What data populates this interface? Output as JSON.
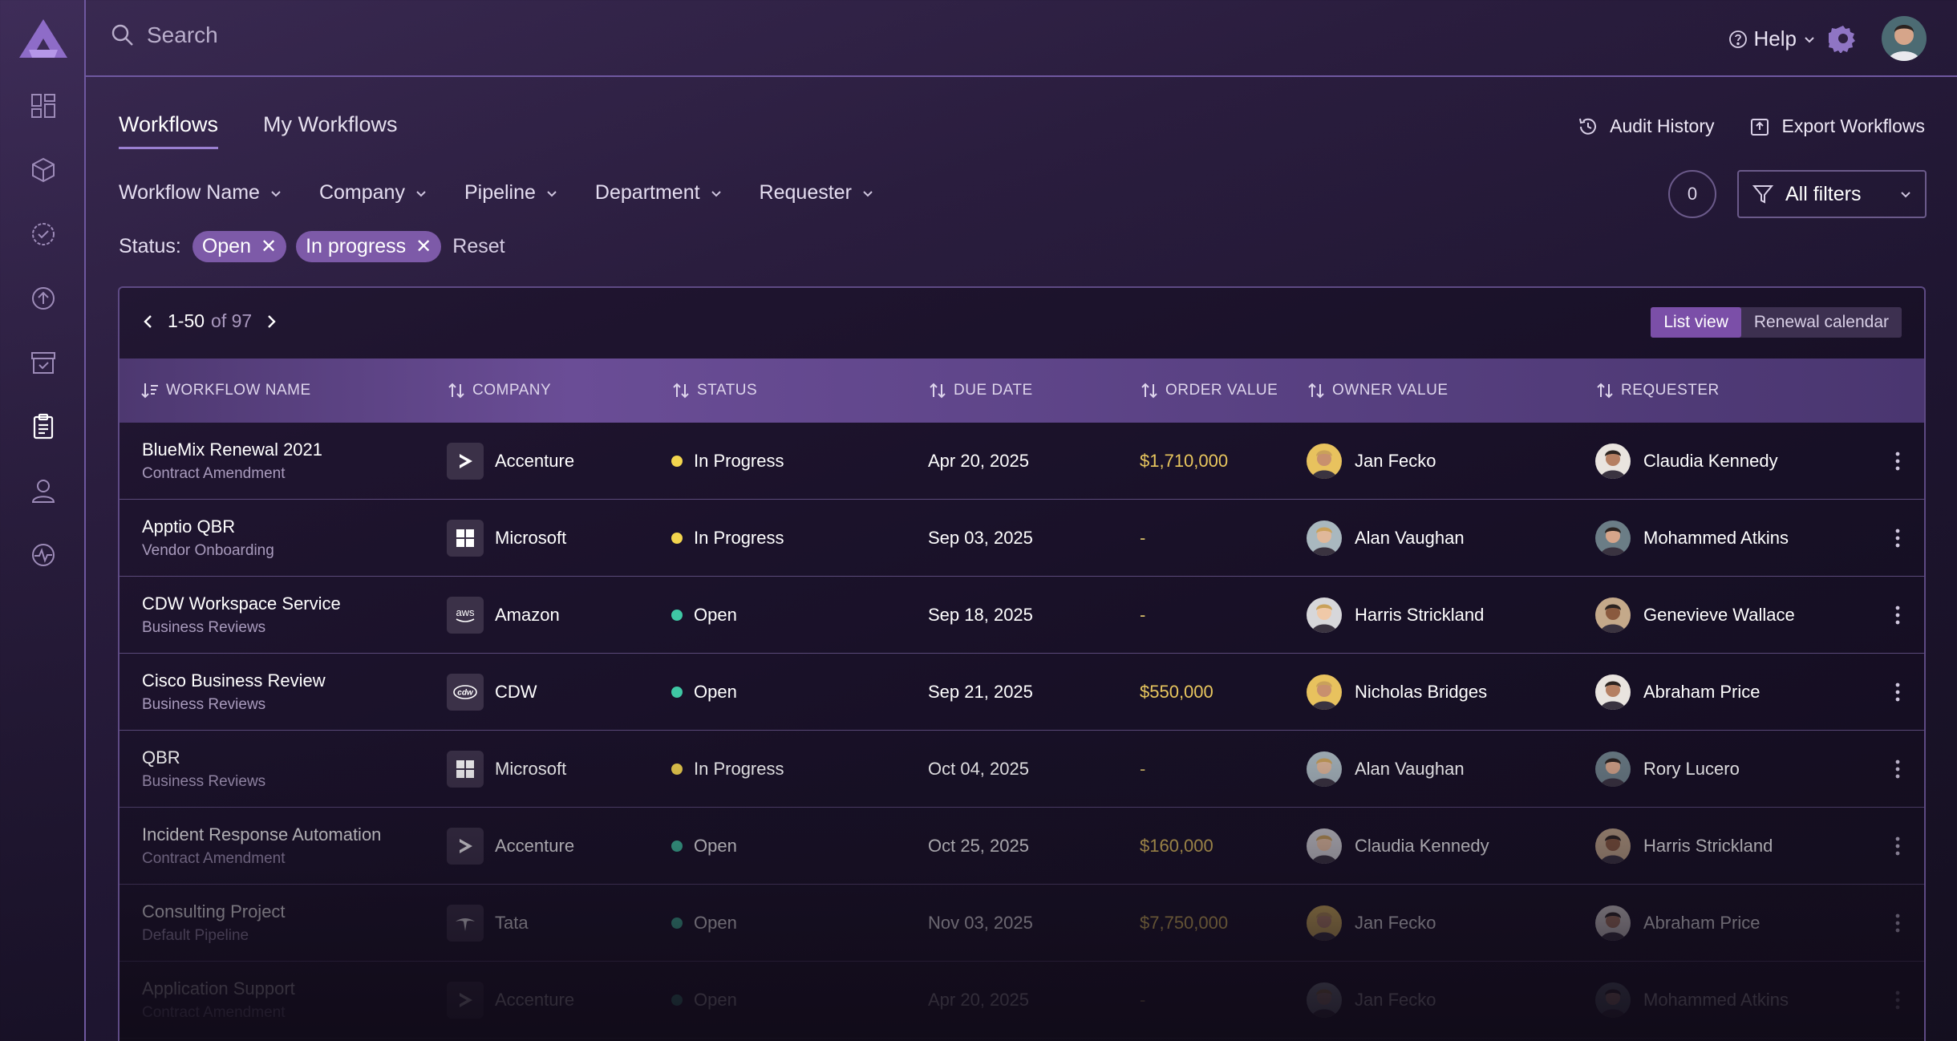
{
  "search": {
    "placeholder": "Search"
  },
  "header": {
    "help_label": "Help"
  },
  "tabs": [
    {
      "label": "Workflows"
    },
    {
      "label": "My Workflows"
    }
  ],
  "actions": {
    "audit": "Audit History",
    "export": "Export Workflows"
  },
  "filters": [
    {
      "label": "Workflow Name"
    },
    {
      "label": "Company"
    },
    {
      "label": "Pipeline"
    },
    {
      "label": "Department"
    },
    {
      "label": "Requester"
    }
  ],
  "filter_count": "0",
  "all_filters_label": "All filters",
  "status_filter": {
    "label": "Status:",
    "chips": [
      "Open",
      "In progress"
    ],
    "reset": "Reset"
  },
  "pager": {
    "range": "1-50",
    "of": "of 97"
  },
  "views": {
    "list": "List view",
    "calendar": "Renewal calendar"
  },
  "columns": [
    "WORKFLOW NAME",
    "COMPANY",
    "STATUS",
    "DUE DATE",
    "ORDER VALUE",
    "OWNER VALUE",
    "REQUESTER"
  ],
  "colors": {
    "accent": "#7b4fa8",
    "in_progress": "#f3d54e",
    "open": "#3fc7a4",
    "value": "#e9c75e"
  },
  "rows": [
    {
      "name": "BlueMix Renewal 2021",
      "pipeline": "Contract Amendment",
      "company": "Accenture",
      "company_icon": "accenture-icon",
      "status": "In Progress",
      "due": "Apr 20, 2025",
      "value": "$1,710,000",
      "owner": "Jan Fecko",
      "requester": "Claudia Kennedy"
    },
    {
      "name": "Apptio QBR",
      "pipeline": "Vendor Onboarding",
      "company": "Microsoft",
      "company_icon": "microsoft-icon",
      "status": "In Progress",
      "due": "Sep 03, 2025",
      "value": "-",
      "owner": "Alan Vaughan",
      "requester": "Mohammed Atkins"
    },
    {
      "name": "CDW Workspace Service",
      "pipeline": "Business Reviews",
      "company": "Amazon",
      "company_icon": "aws-icon",
      "status": "Open",
      "due": "Sep 18, 2025",
      "value": "-",
      "owner": "Harris Strickland",
      "requester": "Genevieve Wallace"
    },
    {
      "name": "Cisco Business Review",
      "pipeline": "Business Reviews",
      "company": "CDW",
      "company_icon": "cdw-icon",
      "status": "Open",
      "due": "Sep 21, 2025",
      "value": "$550,000",
      "owner": "Nicholas Bridges",
      "requester": "Abraham Price"
    },
    {
      "name": "QBR",
      "pipeline": "Business Reviews",
      "company": "Microsoft",
      "company_icon": "microsoft-icon",
      "status": "In Progress",
      "due": "Oct 04, 2025",
      "value": "-",
      "owner": "Alan Vaughan",
      "requester": "Rory Lucero"
    },
    {
      "name": "Incident Response Automation",
      "pipeline": "Contract Amendment",
      "company": "Accenture",
      "company_icon": "accenture-icon",
      "status": "Open",
      "due": "Oct 25, 2025",
      "value": "$160,000",
      "owner": "Claudia Kennedy",
      "requester": "Harris Strickland"
    },
    {
      "name": "Consulting Project",
      "pipeline": "Default Pipeline",
      "company": "Tata",
      "company_icon": "tata-icon",
      "status": "Open",
      "due": "Nov 03, 2025",
      "value": "$7,750,000",
      "owner": "Jan Fecko",
      "requester": "Abraham Price"
    },
    {
      "name": "Application Support",
      "pipeline": "Contract Amendment",
      "company": "Accenture",
      "company_icon": "accenture-icon",
      "status": "Open",
      "due": "Apr 20, 2025",
      "value": "-",
      "owner": "Jan Fecko",
      "requester": "Mohammed Atkins"
    }
  ]
}
